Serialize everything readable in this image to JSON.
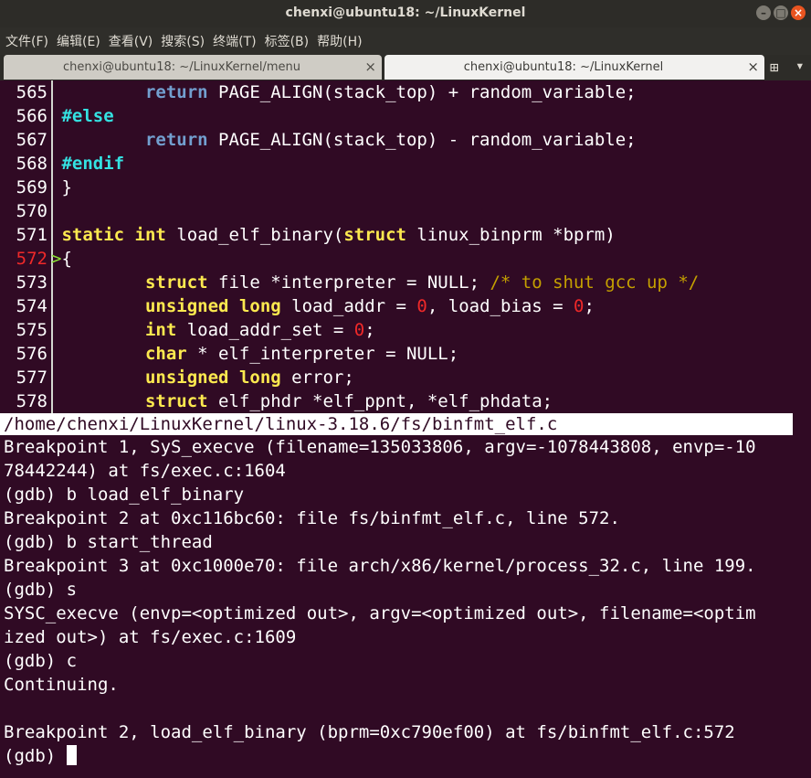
{
  "window": {
    "title": "chenxi@ubuntu18: ~/LinuxKernel",
    "minimize_glyph": "–",
    "maximize_glyph": "□",
    "close_glyph": "×"
  },
  "menu": [
    "文件(F)",
    "编辑(E)",
    "查看(V)",
    "搜索(S)",
    "终端(T)",
    "标签(B)",
    "帮助(H)"
  ],
  "tabs": [
    {
      "label": "chenxi@ubuntu18: ~/LinuxKernel/menu",
      "close_glyph": "×",
      "active": false
    },
    {
      "label": "chenxi@ubuntu18: ~/LinuxKernel",
      "close_glyph": "×",
      "active": true
    }
  ],
  "tab_icons": {
    "new_tab": "⊞",
    "tab_menu": "▾"
  },
  "source": {
    "current_line": "572",
    "current_marker": ">",
    "lines": [
      {
        "num": "565",
        "indent": "        ",
        "parts": [
          [
            "ret",
            "return"
          ],
          [
            "t",
            " PAGE_ALIGN(stack_top) + random_variable;"
          ]
        ]
      },
      {
        "num": "566",
        "indent": "",
        "parts": [
          [
            "pp",
            "#else"
          ]
        ]
      },
      {
        "num": "567",
        "indent": "        ",
        "parts": [
          [
            "ret",
            "return"
          ],
          [
            "t",
            " PAGE_ALIGN(stack_top) - random_variable;"
          ]
        ]
      },
      {
        "num": "568",
        "indent": "",
        "parts": [
          [
            "pp",
            "#endif"
          ]
        ]
      },
      {
        "num": "569",
        "indent": "",
        "parts": [
          [
            "t",
            "}"
          ]
        ]
      },
      {
        "num": "570",
        "indent": "",
        "parts": []
      },
      {
        "num": "571",
        "indent": "",
        "parts": [
          [
            "kw",
            "static"
          ],
          [
            "t",
            " "
          ],
          [
            "kw",
            "int"
          ],
          [
            "t",
            " load_elf_binary("
          ],
          [
            "kw",
            "struct"
          ],
          [
            "t",
            " linux_binprm *bprm)"
          ]
        ]
      },
      {
        "num": "572",
        "indent": "",
        "parts": [
          [
            "t",
            "{"
          ]
        ]
      },
      {
        "num": "573",
        "indent": "        ",
        "parts": [
          [
            "kw",
            "struct"
          ],
          [
            "t",
            " file *interpreter = NULL; "
          ],
          [
            "cmt",
            "/* to shut gcc up */"
          ]
        ]
      },
      {
        "num": "574",
        "indent": "        ",
        "parts": [
          [
            "kw",
            "unsigned"
          ],
          [
            "t",
            " "
          ],
          [
            "kw",
            "long"
          ],
          [
            "t",
            " load_addr = "
          ],
          [
            "num",
            "0"
          ],
          [
            "t",
            ", load_bias = "
          ],
          [
            "num",
            "0"
          ],
          [
            "t",
            ";"
          ]
        ]
      },
      {
        "num": "575",
        "indent": "        ",
        "parts": [
          [
            "kw",
            "int"
          ],
          [
            "t",
            " load_addr_set = "
          ],
          [
            "num",
            "0"
          ],
          [
            "t",
            ";"
          ]
        ]
      },
      {
        "num": "576",
        "indent": "        ",
        "parts": [
          [
            "kw",
            "char"
          ],
          [
            "t",
            " * elf_interpreter = NULL;"
          ]
        ]
      },
      {
        "num": "577",
        "indent": "        ",
        "parts": [
          [
            "kw",
            "unsigned"
          ],
          [
            "t",
            " "
          ],
          [
            "kw",
            "long"
          ],
          [
            "t",
            " error;"
          ]
        ]
      },
      {
        "num": "578",
        "indent": "        ",
        "parts": [
          [
            "kw",
            "struct"
          ],
          [
            "t",
            " elf_phdr *elf_ppnt, *elf_phdata;"
          ]
        ]
      }
    ]
  },
  "status_path": "/home/chenxi/LinuxKernel/linux-3.18.6/fs/binfmt_elf.c",
  "gdb_lines": [
    "Breakpoint 1, SyS_execve (filename=135033806, argv=-1078443808, envp=-10",
    "78442244) at fs/exec.c:1604",
    "(gdb) b load_elf_binary",
    "Breakpoint 2 at 0xc116bc60: file fs/binfmt_elf.c, line 572.",
    "(gdb) b start_thread",
    "Breakpoint 3 at 0xc1000e70: file arch/x86/kernel/process_32.c, line 199.",
    "(gdb) s",
    "SYSC_execve (envp=<optimized out>, argv=<optimized out>, filename=<optim",
    "ized out>) at fs/exec.c:1609",
    "(gdb) c",
    "Continuing.",
    "",
    "Breakpoint 2, load_elf_binary (bprm=0xc790ef00) at fs/binfmt_elf.c:572",
    "(gdb) "
  ],
  "colors": {
    "terminal_bg": "#300a24",
    "keyword": "#fce94f",
    "return_kw": "#729fcf",
    "preprocessor": "#34e2e2",
    "number": "#ef2929",
    "comment": "#c4a000",
    "current_line_number": "#ef2929",
    "arrow": "#8ae234"
  }
}
